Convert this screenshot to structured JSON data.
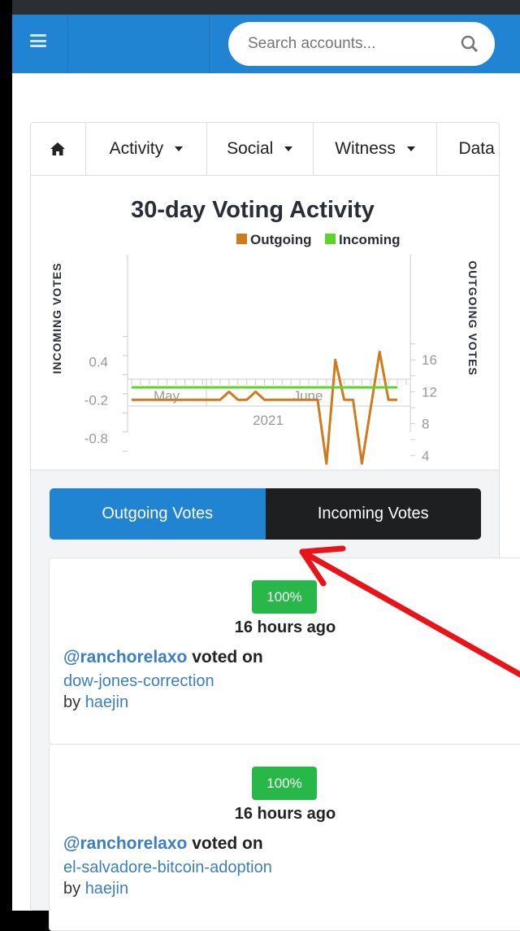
{
  "header": {
    "search_placeholder": "Search accounts...",
    "menu_icon": "hamburger-icon",
    "search_icon": "search-icon"
  },
  "nav": {
    "home_icon": "home-icon",
    "items": [
      {
        "label": "Activity"
      },
      {
        "label": "Social"
      },
      {
        "label": "Witness"
      },
      {
        "label": "Data"
      }
    ]
  },
  "chart_data": {
    "type": "line",
    "title": "30-day Voting Activity",
    "legend": [
      "Outgoing",
      "Incoming"
    ],
    "legend_placement": "top-right",
    "colors": {
      "Outgoing": "#d17a1c",
      "Incoming": "#5ed427"
    },
    "ylabel_left": "INCOMING VOTES",
    "ylabel_right": "OUTGOING VOTES",
    "left_ticks": [
      "0.4",
      "-0.2",
      "-0.8"
    ],
    "right_ticks": [
      "16",
      "12",
      "8",
      "4"
    ],
    "x_month_labels": [
      "May",
      "June"
    ],
    "x_year_label": "2021",
    "series": [
      {
        "name": "Outgoing",
        "axis": "right",
        "values": [
          11,
          11,
          11,
          11,
          11,
          11,
          11,
          11,
          11,
          11,
          11,
          12,
          11,
          11,
          12,
          11,
          11,
          11,
          11,
          11,
          11,
          11,
          3,
          16,
          11,
          11,
          3,
          10,
          17,
          11,
          11
        ]
      },
      {
        "name": "Incoming",
        "axis": "left",
        "values": [
          0,
          0,
          0,
          0,
          0,
          0,
          0,
          0,
          0,
          0,
          0,
          0,
          0,
          0,
          0,
          0,
          0,
          0,
          0,
          0,
          0,
          0,
          0,
          0,
          0,
          0,
          0,
          0,
          0,
          0,
          0
        ]
      }
    ]
  },
  "tabs": {
    "outgoing": "Outgoing Votes",
    "incoming": "Incoming Votes",
    "active": "Outgoing Votes"
  },
  "votes": [
    {
      "percent": "100%",
      "time": "16 hours ago",
      "voter": "@ranchorelaxo",
      "action": "voted on",
      "post": "dow-jones-correction",
      "by": "by",
      "author": "haejin"
    },
    {
      "percent": "100%",
      "time": "16 hours ago",
      "voter": "@ranchorelaxo",
      "action": "voted on",
      "post": "el-salvadore-bitcoin-adoption",
      "by": "by",
      "author": "haejin"
    }
  ]
}
